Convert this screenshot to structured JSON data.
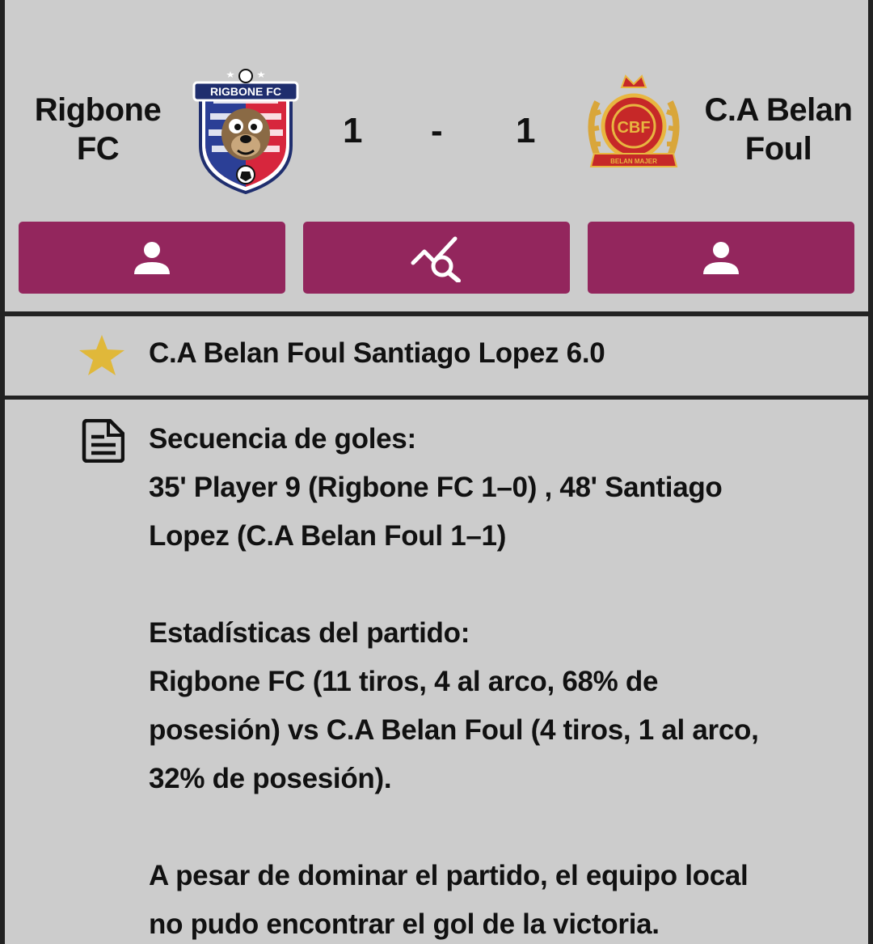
{
  "match": {
    "home": {
      "name_line1": "Rigbone",
      "name_line2": "FC",
      "score": "1",
      "crest_text": "RIGBONE FC"
    },
    "separator": "-",
    "away": {
      "name_line1": "C.A Belan",
      "name_line2": "Foul",
      "score": "1",
      "crest_text": "BELAN MAJER"
    }
  },
  "buttons": [
    {
      "icon": "person-icon"
    },
    {
      "icon": "stats-search-icon"
    },
    {
      "icon": "person-icon"
    }
  ],
  "featured": {
    "icon": "star-icon",
    "text": "C.A Belan Foul Santiago Lopez 6.0"
  },
  "summary": {
    "icon": "document-icon",
    "goals_title": "Secuencia de goles:",
    "goals_line1": "35' Player 9 (Rigbone FC 1–0) , 48' Santiago",
    "goals_line2": "Lopez (C.A Belan Foul 1–1)",
    "stats_title": "Estadísticas del partido:",
    "stats_line1": "Rigbone FC (11 tiros, 4 al arco, 68% de",
    "stats_line2": "posesión) vs C.A Belan Foul (4 tiros, 1 al arco,",
    "stats_line3": "32% de posesión).",
    "comment_line1": "A pesar de dominar el partido, el equipo local",
    "comment_line2": "no pudo encontrar el gol de la victoria."
  },
  "colors": {
    "background": "#cccccc",
    "button": "#93265d",
    "star": "#e0b83a",
    "divider": "#222222"
  }
}
